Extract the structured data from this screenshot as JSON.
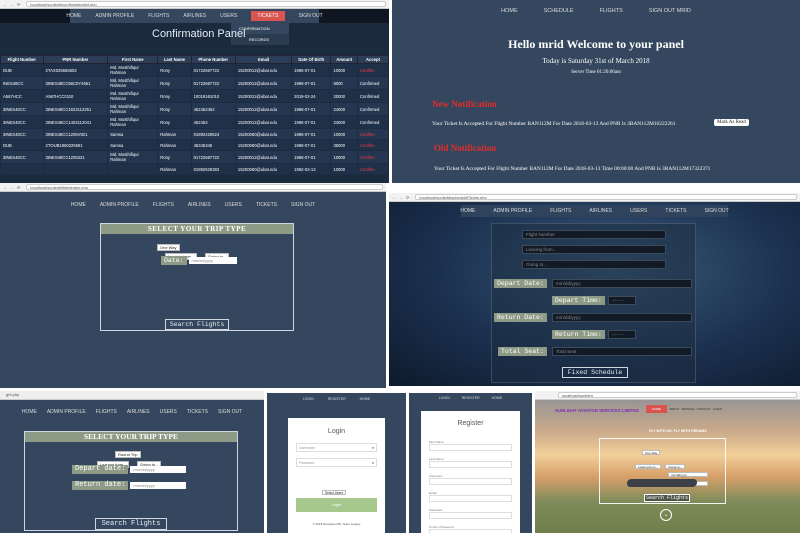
{
  "p1": {
    "url": "localhost/sunlight/confirmationlist.php",
    "nav": [
      "HOME",
      "ADMIN PROFILE",
      "FLIGHTS",
      "AIRLINES",
      "USERS",
      "TICKETS",
      "SIGN OUT"
    ],
    "dropdown": [
      "CONFIRMATION",
      "RECORDS"
    ],
    "title": "Confirmation Panel",
    "headers": [
      "Flight Number",
      "PNR Number",
      "First Name",
      "Last Name",
      "Phone Number",
      "Email",
      "Date Of Birth",
      "Amount",
      "Accept"
    ],
    "rows": [
      [
        "DUB",
        "2TAX025655802",
        "Md. Mosthifiqur Rahman",
        "Rony",
        "01722667722",
        "15200012@ubat.edu",
        "1996-07-01",
        "10000",
        "Confirm"
      ],
      [
        "INES48CC",
        "3INES48CC56C0Y4651",
        "Md. Mosthifiqur Rahman",
        "Rony",
        "01722667722",
        "15200012@ubat.edu",
        "1996-07-01",
        "8000",
        "Confirmed"
      ],
      [
        "A567HCC",
        "A567HCC0110",
        "Md. Mosthifiqur Rahman",
        "Rony",
        "10019161010",
        "15200012@ubat.edu",
        "2019-02-24",
        "20000",
        "Confirmed"
      ],
      [
        "3INES48CC",
        "3INES48CC1622112251",
        "Md. Mosthifiqur Rahman",
        "Rony",
        "452452452",
        "15200012@ubat.edu",
        "1996-07-01",
        "24000",
        "Confirmed"
      ],
      [
        "3INES48CC",
        "3INES48CC1402112041",
        "Md. Mosthifiqur Rahman",
        "Rony",
        "452453",
        "15200012@ubat.edu",
        "1996-07-01",
        "24000",
        "Confirmed"
      ],
      [
        "3INES48CC",
        "3INES48CC1205V821",
        "Samsa",
        "Rahman",
        "01892428624",
        "15200060@ubat.edu",
        "1996-07-01",
        "10000",
        "Confirm"
      ],
      [
        "DUB",
        "2TOUB1950225591",
        "Samsa",
        "Rahman",
        "45345345",
        "15200060@ubat.edu",
        "1996-07-01",
        "36000",
        "Confirm"
      ],
      [
        "3INES48CC",
        "3INES48CC1205321",
        "Md. Mosthifiqur Rahman",
        "Rony",
        "01722667722",
        "15200012@ubat.edu",
        "1996-07-01",
        "10000",
        "Confirm"
      ],
      [
        "",
        "",
        "",
        "Rahman",
        "01892628383",
        "15200060@ubat.edu",
        "1992-02-13",
        "10000",
        "Confirm"
      ]
    ]
  },
  "p2": {
    "nav": [
      "HOME",
      "SCHEDULE",
      "FLIGHTS",
      "SIGN OUT MRID"
    ],
    "welcome": "Hello mrid Welcome to your panel",
    "date": "Today is Saturday 31st of March 2018",
    "time": "Server Time 01:20:06am",
    "new_title": "New Notification",
    "new_msg": "Your Ticket Is Accepted For Flight Number BAN112M For Date 2018-03-13 And PNR Is 3BAN112M16222261",
    "mark": "Mark As Read",
    "old_title": "Old Notification",
    "old_msg": "Your Ticket Is Accepted For Flight Number BAN112M For Date 2018-03-13 Time 00:00:00 And PNR Is 3BAN112M17322371"
  },
  "p3": {
    "url": "localhost/sunlight/flightindex.php",
    "nav": [
      "HOME",
      "ADMIN PROFILE",
      "FLIGHTS",
      "AIRLINES",
      "USERS",
      "TICKETS",
      "SIGN OUT"
    ],
    "title": "SELECT YOUR TRIP TYPE",
    "trip": "One Way",
    "leaving": "Leaving from...",
    "going": "Going to...",
    "date_label": "Date:",
    "date_ph": "mm/dd/yyyy",
    "button": "Search Flights"
  },
  "p4": {
    "url": "localhost/sunlight/scheduleFlights.php",
    "nav": [
      "HOME",
      "ADMIN PROFILE",
      "FLIGHTS",
      "AIRLINES",
      "USERS",
      "TICKETS",
      "SIGN OUT"
    ],
    "flight_ph": "Flight Number",
    "leaving": "Leaving from...",
    "going": "Going to...",
    "depart_date": "Depart Date:",
    "depart_time": "Depart Time:",
    "return_date": "Return Date:",
    "return_time": "Return Time:",
    "total_seat": "Total Seat:",
    "date_ph": "mm/dd/yyyy",
    "time_ph": "--:-- --",
    "seat_ph": "Total Seat",
    "button": "Fixed Schedule"
  },
  "p5": {
    "url": "ght.php",
    "nav": [
      "HOME",
      "ADMIN PROFILE",
      "FLIGHTS",
      "AIRLINES",
      "USERS",
      "TICKETS",
      "SIGN OUT"
    ],
    "title": "SELECT YOUR TRIP TYPE",
    "trip": "Round Trip",
    "leaving": "Leaving from...",
    "going": "Going to...",
    "depart_label": "Depart date:",
    "return_label": "Return date:",
    "date_ph": "mm/dd/yyyy",
    "button": "Search Flights"
  },
  "p6": {
    "nav": [
      "LOGIN",
      "REGISTER",
      "HOME"
    ],
    "title": "Login",
    "user_ph": "Username",
    "pass_ph": "Password",
    "select": "Select Users",
    "button": "Login",
    "footer": "© 2018 Developed By Team Legacy"
  },
  "p7": {
    "nav": [
      "LOGIN",
      "REGISTER",
      "HOME"
    ],
    "title": "Register",
    "fields": [
      "First Name",
      "Last Name",
      "Username",
      "Email",
      "Password",
      "Confirm Password"
    ]
  },
  "p8": {
    "url": "localhost/sunlight",
    "brand": "SUNLIGHT AVIATION SERVICES LIMITED",
    "nav": [
      "HOME",
      "ABOUT",
      "SERVICE",
      "CONTACT",
      "LOGIN"
    ],
    "tagline": "FLY WITH US, FLY WITH DREAMS",
    "trip": "One Way",
    "leaving": "Leaving from...",
    "going": "Going to...",
    "date_ph": "mm/dd/yyyy",
    "button": "Search Flights"
  }
}
